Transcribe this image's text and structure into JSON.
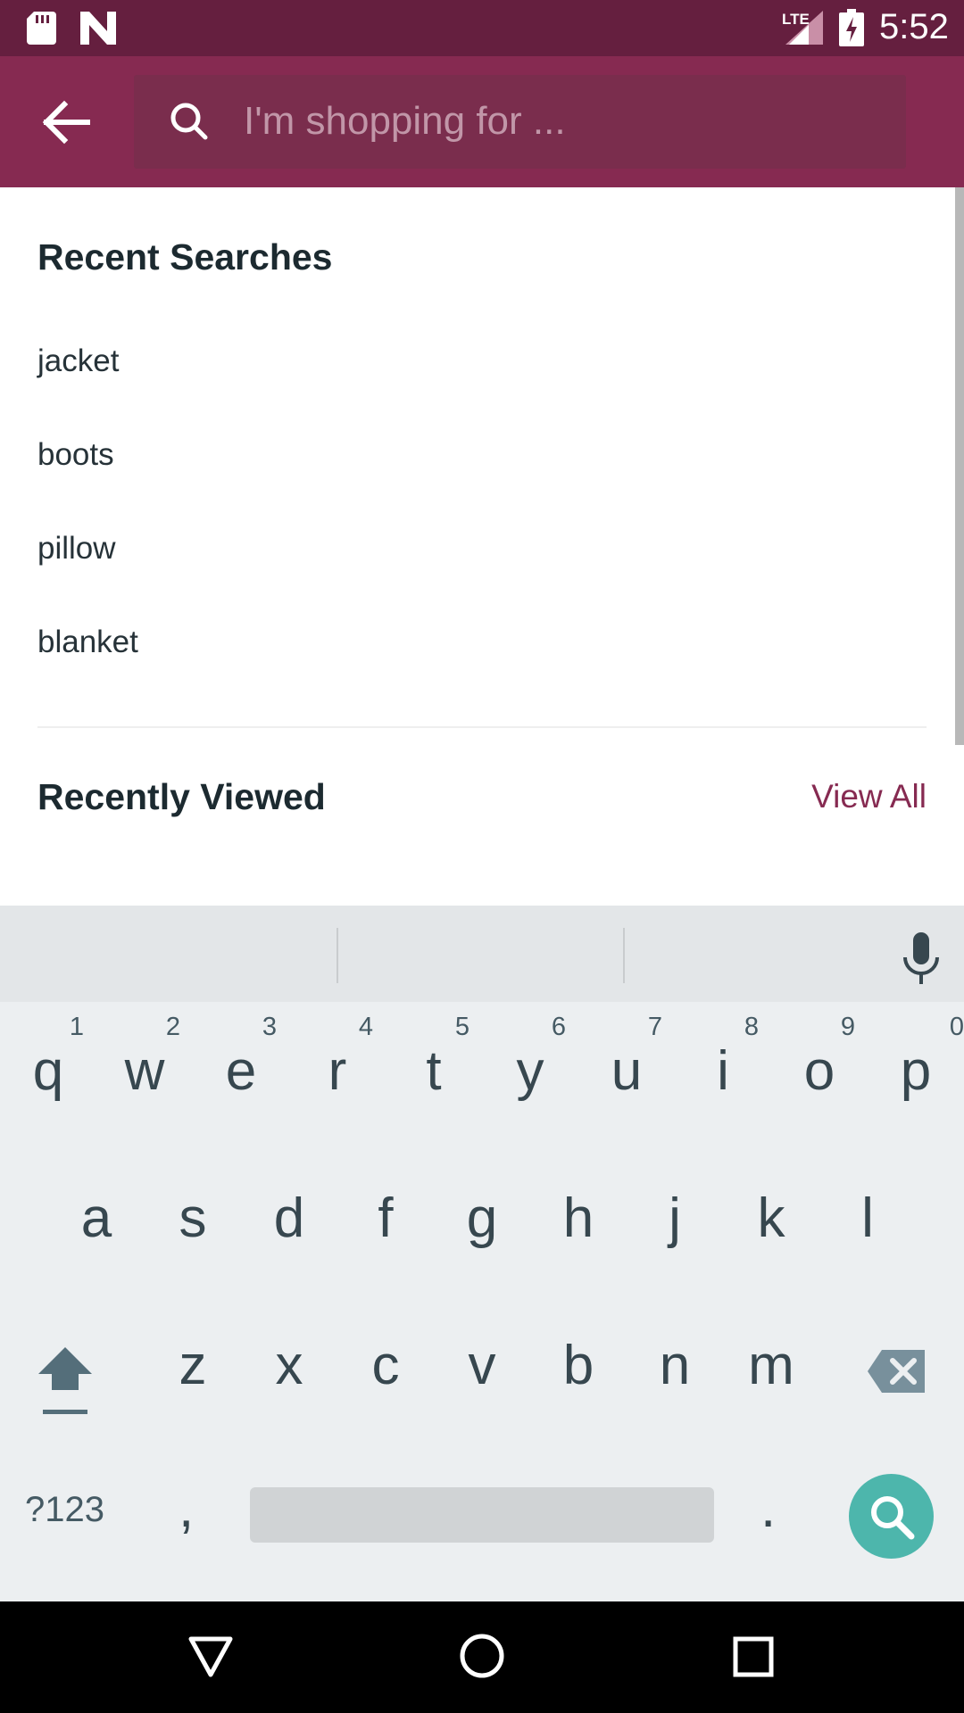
{
  "status_bar": {
    "network": "LTE",
    "time": "5:52",
    "icons": [
      "sd-card-icon",
      "n-notification-icon",
      "signal-icon",
      "battery-charging-icon"
    ]
  },
  "app_bar": {
    "back_icon": "arrow-back-icon",
    "search": {
      "placeholder": "I'm shopping for ...",
      "value": "",
      "icon": "search-icon"
    },
    "colors": {
      "primary": "#862a51",
      "dark": "#651f3f"
    }
  },
  "recent_searches": {
    "title": "Recent Searches",
    "items": [
      "jacket",
      "boots",
      "pillow",
      "blanket"
    ]
  },
  "recently_viewed": {
    "title": "Recently Viewed",
    "view_all_label": "View All"
  },
  "keyboard": {
    "row1": [
      {
        "letter": "q",
        "hint": "1"
      },
      {
        "letter": "w",
        "hint": "2"
      },
      {
        "letter": "e",
        "hint": "3"
      },
      {
        "letter": "r",
        "hint": "4"
      },
      {
        "letter": "t",
        "hint": "5"
      },
      {
        "letter": "y",
        "hint": "6"
      },
      {
        "letter": "u",
        "hint": "7"
      },
      {
        "letter": "i",
        "hint": "8"
      },
      {
        "letter": "o",
        "hint": "9"
      },
      {
        "letter": "p",
        "hint": "0"
      }
    ],
    "row2": [
      "a",
      "s",
      "d",
      "f",
      "g",
      "h",
      "j",
      "k",
      "l"
    ],
    "row3": [
      "z",
      "x",
      "c",
      "v",
      "b",
      "n",
      "m"
    ],
    "symbols_label": "?123",
    "comma_label": ",",
    "period_label": ".",
    "action_icon": "search-icon",
    "accent_color": "#4db6ac"
  },
  "nav_bar": {
    "icons": [
      "back-triangle-icon",
      "home-circle-icon",
      "recents-square-icon"
    ]
  }
}
